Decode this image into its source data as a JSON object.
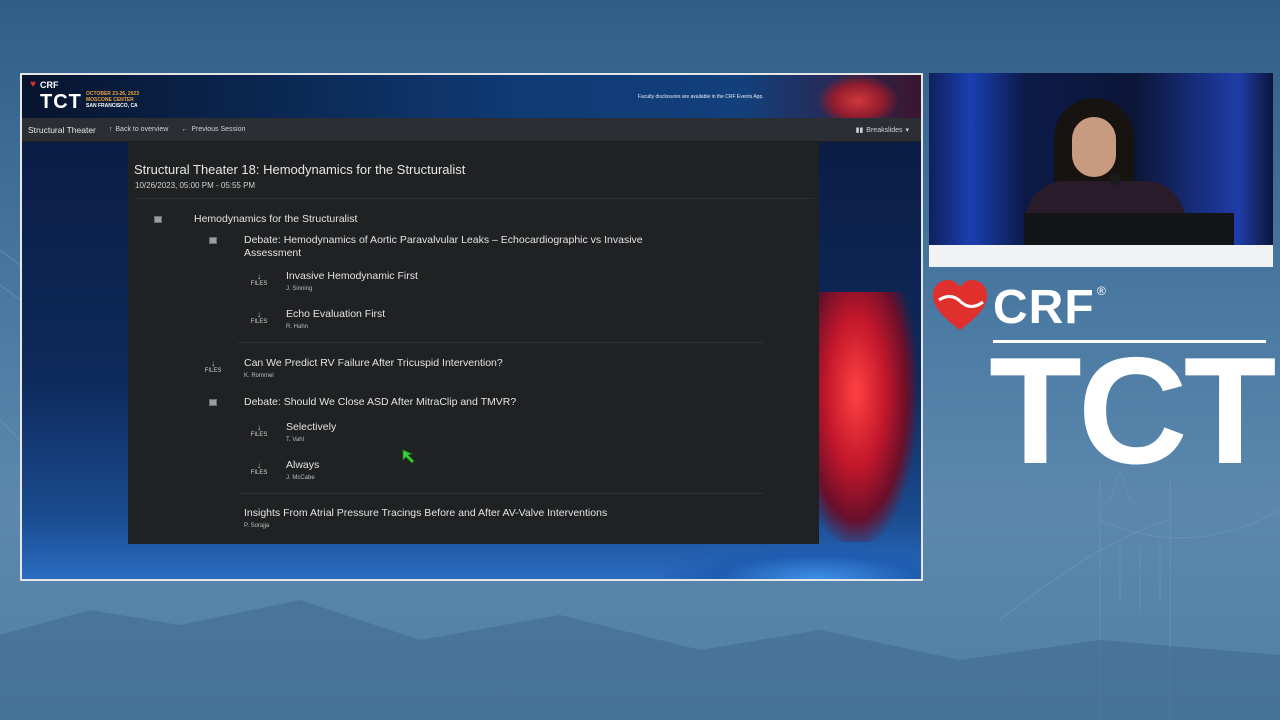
{
  "banner": {
    "brand_small": "CRF",
    "logo_small": "TCT",
    "event_dates": "OCTOBER 23-26, 2023",
    "event_venue": "MOSCONE CENTER",
    "event_city": "SAN FRANCISCO, CA",
    "disclosure": "Faculty disclosures are available in the CRF Events App."
  },
  "navbar": {
    "brand": "Structural Theater",
    "back_label": "Back to overview",
    "prev_label": "Previous Session",
    "breakslides_label": "Breakslides"
  },
  "session": {
    "title": "Structural Theater 18: Hemodynamics for the Structuralist",
    "datetime": "10/26/2023, 05:00 PM - 05:55 PM"
  },
  "agenda": {
    "files_label": "FILES",
    "section_title": "Hemodynamics for the Structuralist",
    "debate1": {
      "title": "Debate: Hemodynamics of Aortic Paravalvular Leaks – Echocardiographic vs Invasive Assessment",
      "talks": [
        {
          "title": "Invasive Hemodynamic First",
          "speaker": "J. Sinning"
        },
        {
          "title": "Echo Evaluation First",
          "speaker": "R. Hahn"
        }
      ]
    },
    "talk_rv": {
      "title": "Can We Predict RV Failure After Tricuspid Intervention?",
      "speaker": "K. Rommel"
    },
    "debate2": {
      "title": "Debate: Should We Close ASD After MitraClip and TMVR?",
      "talks": [
        {
          "title": "Selectively",
          "speaker": "T. Vahl"
        },
        {
          "title": "Always",
          "speaker": "J. McCabe"
        }
      ]
    },
    "talk_atrial": {
      "title": "Insights From Atrial Pressure Tracings Before and After AV-Valve Interventions",
      "speaker": "P. Sorajja"
    }
  },
  "brand": {
    "crf": "CRF",
    "reg": "®",
    "tct": "TCT"
  },
  "colors": {
    "accent_red": "#e0302e",
    "panel_bg": "#1f2123",
    "navbar_bg": "#2b2e32",
    "cursor_green": "#3cd23c"
  }
}
